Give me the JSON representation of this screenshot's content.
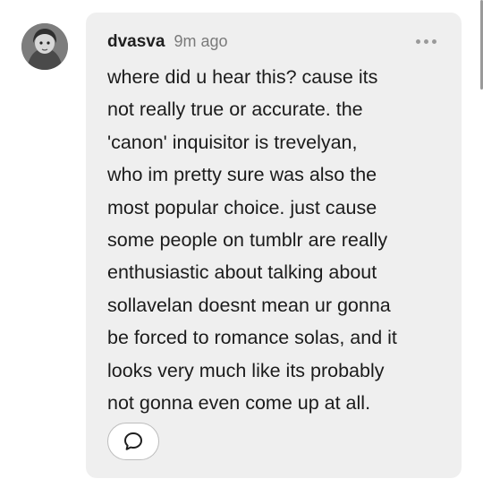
{
  "comment": {
    "author": "dvasva",
    "timestamp": "9m ago",
    "text": "where did u hear this? cause its\nnot really true or accurate. the\n'canon' inquisitor is trevelyan,\nwho im pretty sure was also the\nmost popular choice. just cause\nsome people on tumblr are really\nenthusiastic about talking about\nsollavelan doesnt mean ur gonna\nbe forced to romance solas, and it\nlooks very much like its probably\nnot gonna even come up at all.",
    "avatar_icon": "user-avatar",
    "more_icon": "more-horizontal-icon",
    "reply_icon": "speech-bubble-icon"
  }
}
